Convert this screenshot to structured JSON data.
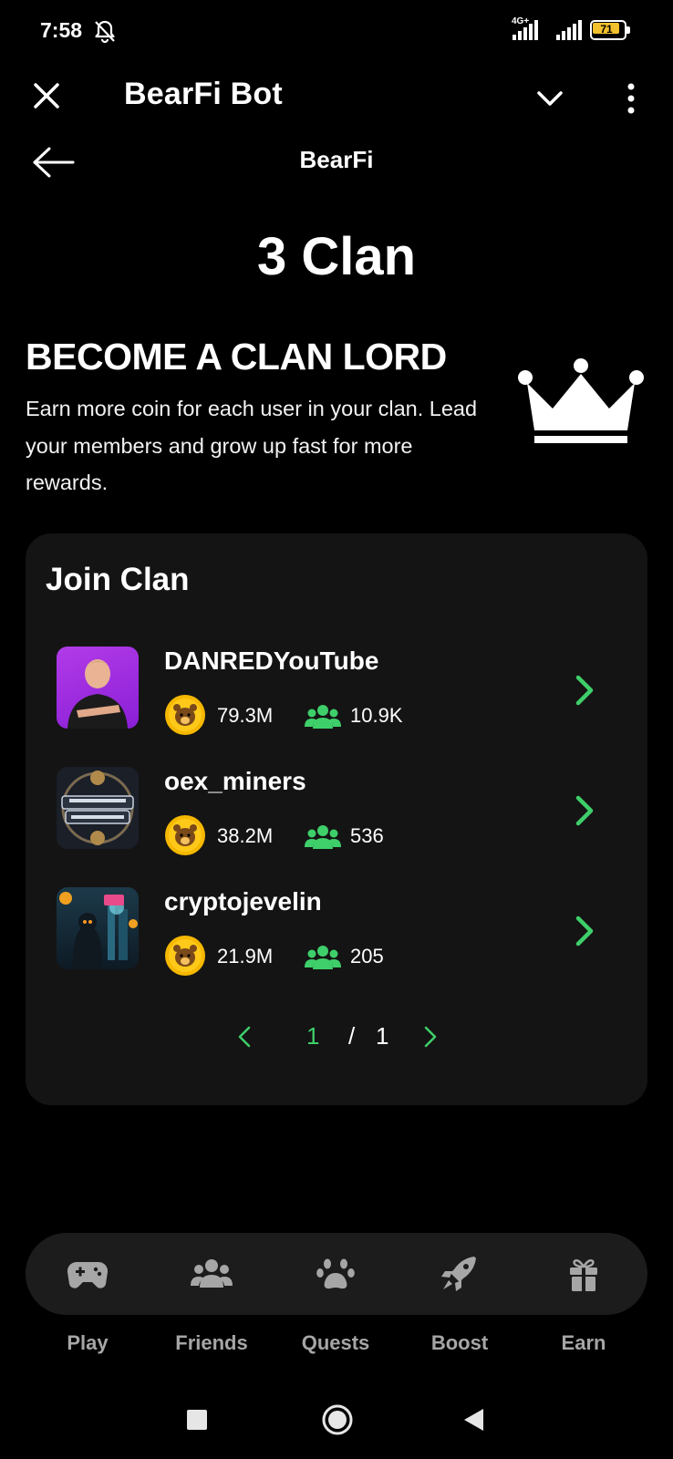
{
  "status_bar": {
    "time": "7:58",
    "network_label": "4G+",
    "battery_level": "71"
  },
  "telegram_header": {
    "title": "BearFi Bot"
  },
  "app_header": {
    "title": "BearFi"
  },
  "clan_count": "3 Clan",
  "promo": {
    "title": "BECOME A CLAN LORD",
    "description": "Earn more coin for each user in your clan. Lead your members and grow up fast for more rewards."
  },
  "join_clan": {
    "title": "Join Clan",
    "clans": [
      {
        "name": "DANREDYouTube",
        "coins": "79.3M",
        "members": "10.9K"
      },
      {
        "name": "oex_miners",
        "coins": "38.2M",
        "members": "536"
      },
      {
        "name": "cryptojevelin",
        "coins": "21.9M",
        "members": "205"
      }
    ],
    "pagination": {
      "current": "1",
      "separator": "/",
      "total": "1"
    }
  },
  "bottom_nav": {
    "items": [
      {
        "label": "Play",
        "icon": "gamepad-icon"
      },
      {
        "label": "Friends",
        "icon": "users-icon"
      },
      {
        "label": "Quests",
        "icon": "paw-icon"
      },
      {
        "label": "Boost",
        "icon": "rocket-icon"
      },
      {
        "label": "Earn",
        "icon": "gift-icon"
      }
    ]
  },
  "colors": {
    "background": "#000000",
    "card": "#141414",
    "accent_green": "#3ecf6a",
    "coin_gold": "#f5b800",
    "nav_label": "#a6a6a6"
  }
}
